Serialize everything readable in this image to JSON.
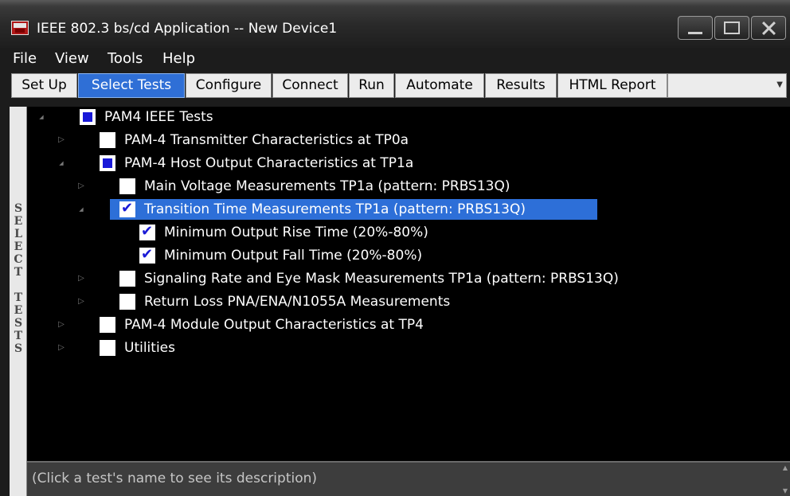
{
  "window": {
    "title": "IEEE 802.3 bs/cd Application -- New Device1",
    "controls": [
      "minimize-icon",
      "maximize-icon",
      "close-icon"
    ]
  },
  "menu": {
    "items": [
      "File",
      "View",
      "Tools",
      "Help"
    ]
  },
  "tabs": {
    "items": [
      "Set Up",
      "Select Tests",
      "Configure",
      "Connect",
      "Run",
      "Automate",
      "Results",
      "HTML Report"
    ],
    "active": "Select Tests"
  },
  "sidebar": {
    "label": "SELECT TESTS"
  },
  "tree": {
    "items": [
      {
        "label": "PAM4 IEEE Tests",
        "state": "partial",
        "expander": "expanded"
      },
      {
        "label": "PAM-4 Transmitter Characteristics at TP0a",
        "state": "unchecked",
        "expander": "collapsed"
      },
      {
        "label": "PAM-4 Host Output Characteristics at TP1a",
        "state": "partial",
        "expander": "expanded"
      },
      {
        "label": "Main Voltage Measurements TP1a (pattern: PRBS13Q)",
        "state": "unchecked",
        "expander": "collapsed"
      },
      {
        "label": "Transition Time Measurements TP1a (pattern: PRBS13Q)",
        "state": "checked",
        "expander": "expanded",
        "selected": true
      },
      {
        "label": "Minimum Output Rise Time (20%-80%)",
        "state": "checked",
        "expander": "none"
      },
      {
        "label": "Minimum Output Fall Time (20%-80%)",
        "state": "checked",
        "expander": "none"
      },
      {
        "label": "Signaling Rate and Eye Mask Measurements TP1a (pattern: PRBS13Q)",
        "state": "unchecked",
        "expander": "collapsed"
      },
      {
        "label": "Return Loss PNA/ENA/N1055A Measurements",
        "state": "unchecked",
        "expander": "collapsed"
      },
      {
        "label": "PAM-4 Module Output Characteristics at TP4",
        "state": "unchecked",
        "expander": "collapsed"
      },
      {
        "label": "Utilities",
        "state": "unchecked",
        "expander": "collapsed"
      }
    ]
  },
  "description": {
    "text": "(Click a test's name to see its description)"
  },
  "colors": {
    "active_tab": "#2f6fd6",
    "selected_row": "#2d6fd8",
    "checkbox_mark": "#1818d8",
    "tree_background": "#000000"
  }
}
